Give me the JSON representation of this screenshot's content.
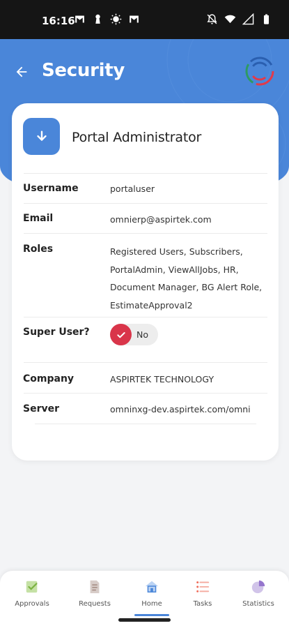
{
  "status_bar": {
    "time": "16:16",
    "left_icons": [
      "gmail-icon",
      "keyhole-icon",
      "sun-icon",
      "gmail-icon"
    ],
    "right_icons": [
      "bell-off-icon",
      "wifi-icon",
      "signal-icon",
      "battery-icon"
    ]
  },
  "header": {
    "title": "Security",
    "back_icon": "back-arrow-icon",
    "logo_icon": "app-logo-icon",
    "color": "#4a86d9"
  },
  "profile": {
    "name": "Portal Administrator",
    "icon": "download-arrow-icon"
  },
  "fields": {
    "username": {
      "label": "Username",
      "value": "portaluser"
    },
    "email": {
      "label": "Email",
      "value": "omnierp@aspirtek.com"
    },
    "roles": {
      "label": "Roles",
      "lines": [
        "Registered Users, Subscribers,",
        "PortalAdmin, ViewAllJobs, HR,",
        "Document Manager, BG Alert Role,",
        "EstimateApproval2"
      ]
    },
    "super_user": {
      "label": "Super User?",
      "value": "No",
      "checked": true,
      "color": "#d9354a"
    },
    "company": {
      "label": "Company",
      "value": "ASPIRTEK TECHNOLOGY"
    },
    "server": {
      "label": "Server",
      "value": "omninxg-dev.aspirtek.com/omni"
    }
  },
  "bottom_nav": {
    "active": "Home",
    "items": [
      {
        "label": "Approvals",
        "icon": "approvals-icon",
        "color": "#8bc34a"
      },
      {
        "label": "Requests",
        "icon": "requests-icon",
        "color": "#a1887f"
      },
      {
        "label": "Home",
        "icon": "home-icon",
        "color": "#4a86d9"
      },
      {
        "label": "Tasks",
        "icon": "tasks-icon",
        "color": "#ef6c5a"
      },
      {
        "label": "Statistics",
        "icon": "statistics-icon",
        "color": "#9575cd"
      }
    ]
  }
}
